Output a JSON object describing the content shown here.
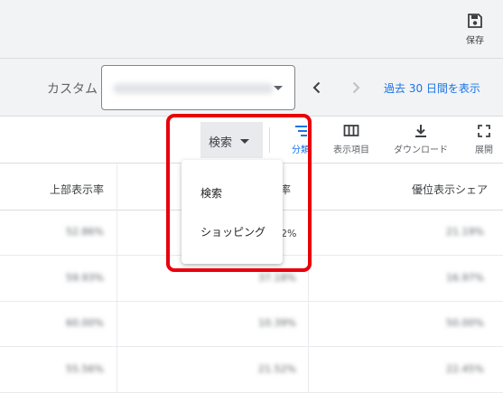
{
  "topbar": {
    "save_label": "保存",
    "save_icon": "save-icon"
  },
  "date_range": {
    "label": "カスタム",
    "value_blurred": "2024年9月1日～9月30日",
    "prev_icon": "chevron-left-icon",
    "next_icon": "chevron-right-icon",
    "show_link": "過去 30 日間を表示"
  },
  "toolbar": {
    "network_select": "検索",
    "segment_label": "分類",
    "segment_icon": "filter-lines-icon",
    "columns_label": "表示項目",
    "columns_icon": "columns-icon",
    "download_label": "ダウンロード",
    "download_icon": "download-icon",
    "expand_label": "展開",
    "expand_icon": "fullscreen-icon"
  },
  "table": {
    "headers": {
      "top_rate": "上部表示率",
      "middle_partial": "率",
      "abs_top_share": "優位表示シェア"
    },
    "rows": [
      {
        "a": "52.86%",
        "b": "",
        "b_visible": "2%",
        "c": "21.19%"
      },
      {
        "a": "59.93%",
        "b": "37.18%",
        "c": "16.97%"
      },
      {
        "a": "60.00%",
        "b": "10.39%",
        "c": "50.00%"
      },
      {
        "a": "55.56%",
        "b": "21.52%",
        "c": "22.45%"
      }
    ]
  },
  "dropdown": {
    "options": [
      "検索",
      "ショッピング"
    ]
  },
  "colors": {
    "accent": "#1a73e8",
    "highlight": "#e8000b",
    "topbar_bg": "#f1f3f4"
  }
}
